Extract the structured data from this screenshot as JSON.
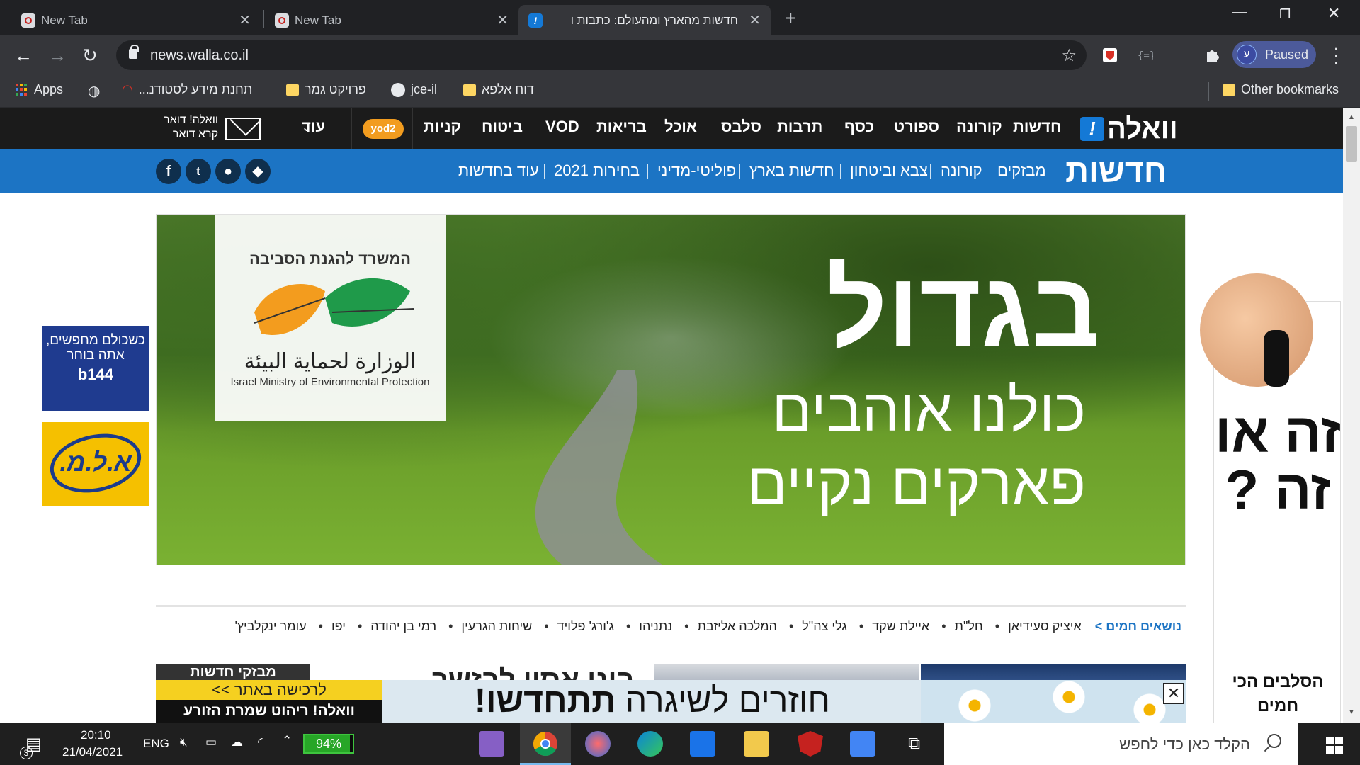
{
  "browser": {
    "tabs": [
      {
        "title": "New Tab"
      },
      {
        "title": "New Tab"
      },
      {
        "title": "חדשות מהארץ ומהעולם: כתבות ו"
      }
    ],
    "url": "news.walla.co.il",
    "profile_label": "Paused",
    "profile_initial": "ע",
    "bookmarks": [
      {
        "label": "Apps"
      },
      {
        "label": "תחנת מידע לסטודנ..."
      },
      {
        "label": "פרויקט גמר"
      },
      {
        "label": "jce-il"
      },
      {
        "label": "דוח אלפא"
      }
    ],
    "other_bookmarks": "Other bookmarks"
  },
  "walla_nav": {
    "logo": "וואלה",
    "items": [
      "חדשות",
      "קורונה",
      "ספורט",
      "כסף",
      "תרבות",
      "סלבס",
      "אוכל",
      "בריאות",
      "VOD",
      "ביטוח",
      "קניות"
    ],
    "yod2": "yod2",
    "more": "עוד",
    "mail_line1": "וואלה! דואר",
    "mail_line2": "קרא דואר"
  },
  "news_nav": {
    "title": "חדשות",
    "items": [
      "מבזקים",
      "קורונה",
      "צבא וביטחון",
      "חדשות בארץ",
      "פוליטי-מדיני",
      "בחירות 2021",
      "עוד בחדשות"
    ],
    "social": [
      "f",
      "t",
      "",
      ""
    ]
  },
  "hero": {
    "line1": "בגדול",
    "line2": "כולנו אוהבים",
    "line3": "פארקים נקיים",
    "ministry_he": "המשרד להגנת הסביבה",
    "ministry_ar": "الوزارة لحماية البيئة",
    "ministry_en": "Israel Ministry of Environmental Protection"
  },
  "hot_topics": {
    "label": "נושאים חמים >",
    "items": [
      "איציק סעידיאן",
      "חל\"ת",
      "איילת שקד",
      "גלי צה\"ל",
      "המלכה אליזבת",
      "נתניהו",
      "ג'ורג' פלויד",
      "שיחות הגרעין",
      "רמי בן יהודה",
      "יפו",
      "עומר ינקלביץ'"
    ]
  },
  "below": {
    "flash": "מבזקי חדשות",
    "headline": "בוני אסון לבזשר"
  },
  "ads": {
    "b144_text": "כשכולם מחפשים, אתה בוחר",
    "b144_brand": "b144",
    "alm": "א.ל.מ.",
    "right_big": "זה או זה ?",
    "right_small": "הסלבים הכי חמים",
    "bottom_yellow": "לרכישה באתר >>",
    "bottom_brand": "וואלה! ריהוט שמרת הזורע",
    "bottom_main_regular": "חוזרים לשיגרה",
    "bottom_main_bold": "תתחדשו!"
  },
  "taskbar": {
    "notifications": "3",
    "time": "20:10",
    "date": "21/04/2021",
    "lang": "ENG",
    "battery": 94,
    "battery_label": "94%",
    "search_placeholder": "הקלד כאן כדי לחפש"
  }
}
